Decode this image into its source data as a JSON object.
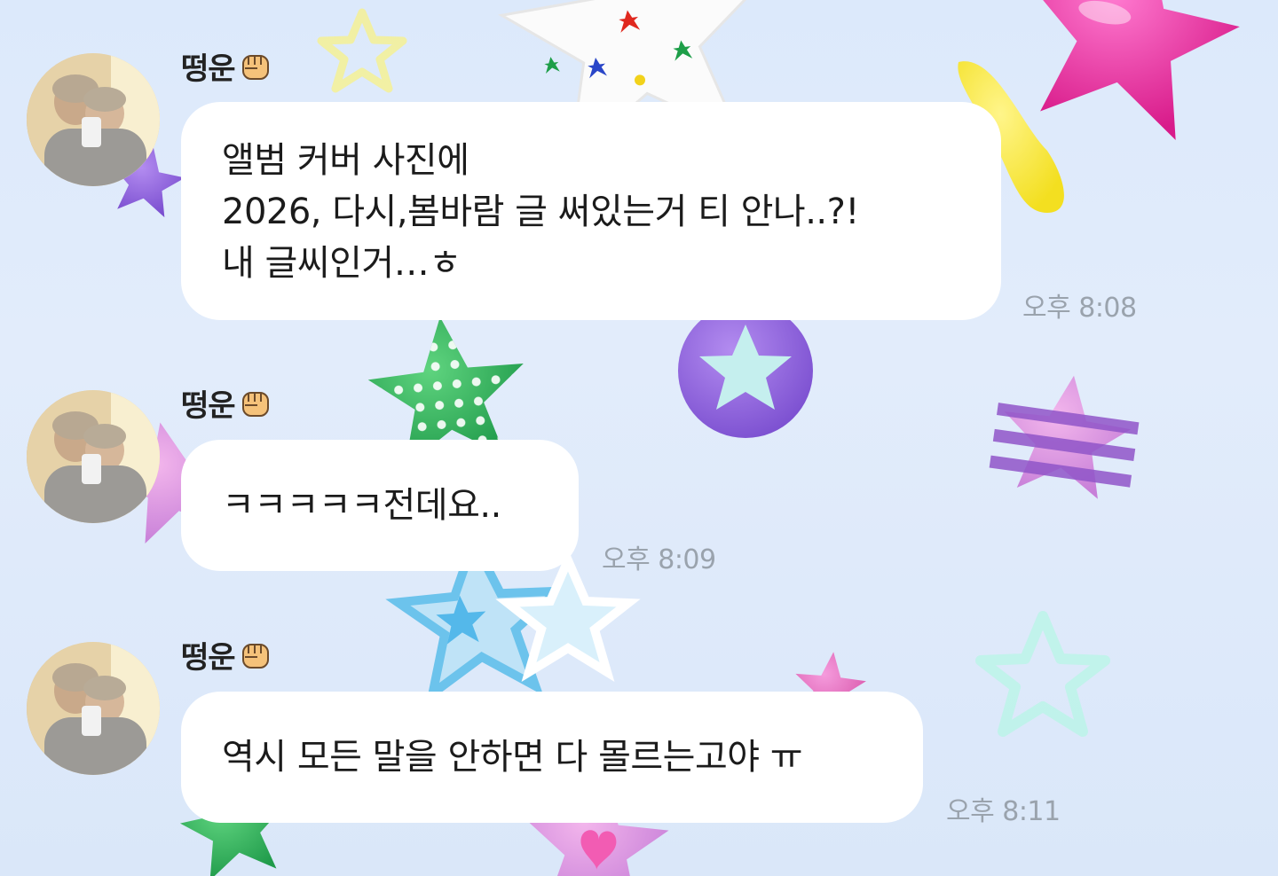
{
  "messages": [
    {
      "sender": "떵운",
      "lines": [
        "앨범 커버 사진에",
        "2026, 다시,봄바람 글 써있는거 티 안나..?!",
        "내 글씨인거…ㅎ"
      ],
      "time": "오후 8:08"
    },
    {
      "sender": "떵운",
      "lines": [
        "ㅋㅋㅋㅋㅋ전데요.."
      ],
      "time": "오후 8:09"
    },
    {
      "sender": "떵운",
      "lines": [
        "역시 모든 말을 안하면 다 몰르는고야 ㅠ"
      ],
      "time": "오후 8:11"
    }
  ],
  "sender_emoji": "raised-fist-icon",
  "colors": {
    "background": "#dce9fb",
    "bubble": "#ffffff",
    "timestamp": "#9aa3ad"
  }
}
